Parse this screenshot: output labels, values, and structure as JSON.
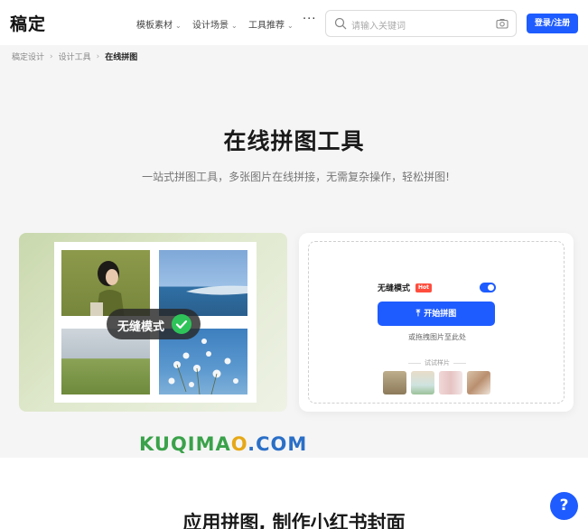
{
  "header": {
    "logo": "稿定",
    "nav": [
      {
        "label": "模板素材"
      },
      {
        "label": "设计场景"
      },
      {
        "label": "工具推荐"
      }
    ],
    "more_label": "···",
    "search": {
      "placeholder": "请输入关键词"
    },
    "login_label": "登录/注册"
  },
  "breadcrumb": {
    "items": [
      "稿定设计",
      "设计工具",
      "在线拼图"
    ]
  },
  "hero": {
    "title": "在线拼图工具",
    "subtitle": "一站式拼图工具，多张图片在线拼接，无需复杂操作，轻松拼图!"
  },
  "preview": {
    "badge_label": "无缝模式"
  },
  "panel": {
    "mode_label": "无缝模式",
    "hot_label": "Hot",
    "toggle_on": true,
    "start_label": "开始拼图",
    "drop_hint": "或拖拽图片至此处",
    "try_label": "试试样片"
  },
  "watermark": {
    "part1": "KUQIMA",
    "part2": "O",
    "part3": ".COM"
  },
  "section": {
    "title": "应用拼图, 制作小红书封面"
  },
  "help_label": "?",
  "colors": {
    "accent": "#1f5cff",
    "hot": "#ff4d3d",
    "check": "#2ec45a"
  }
}
